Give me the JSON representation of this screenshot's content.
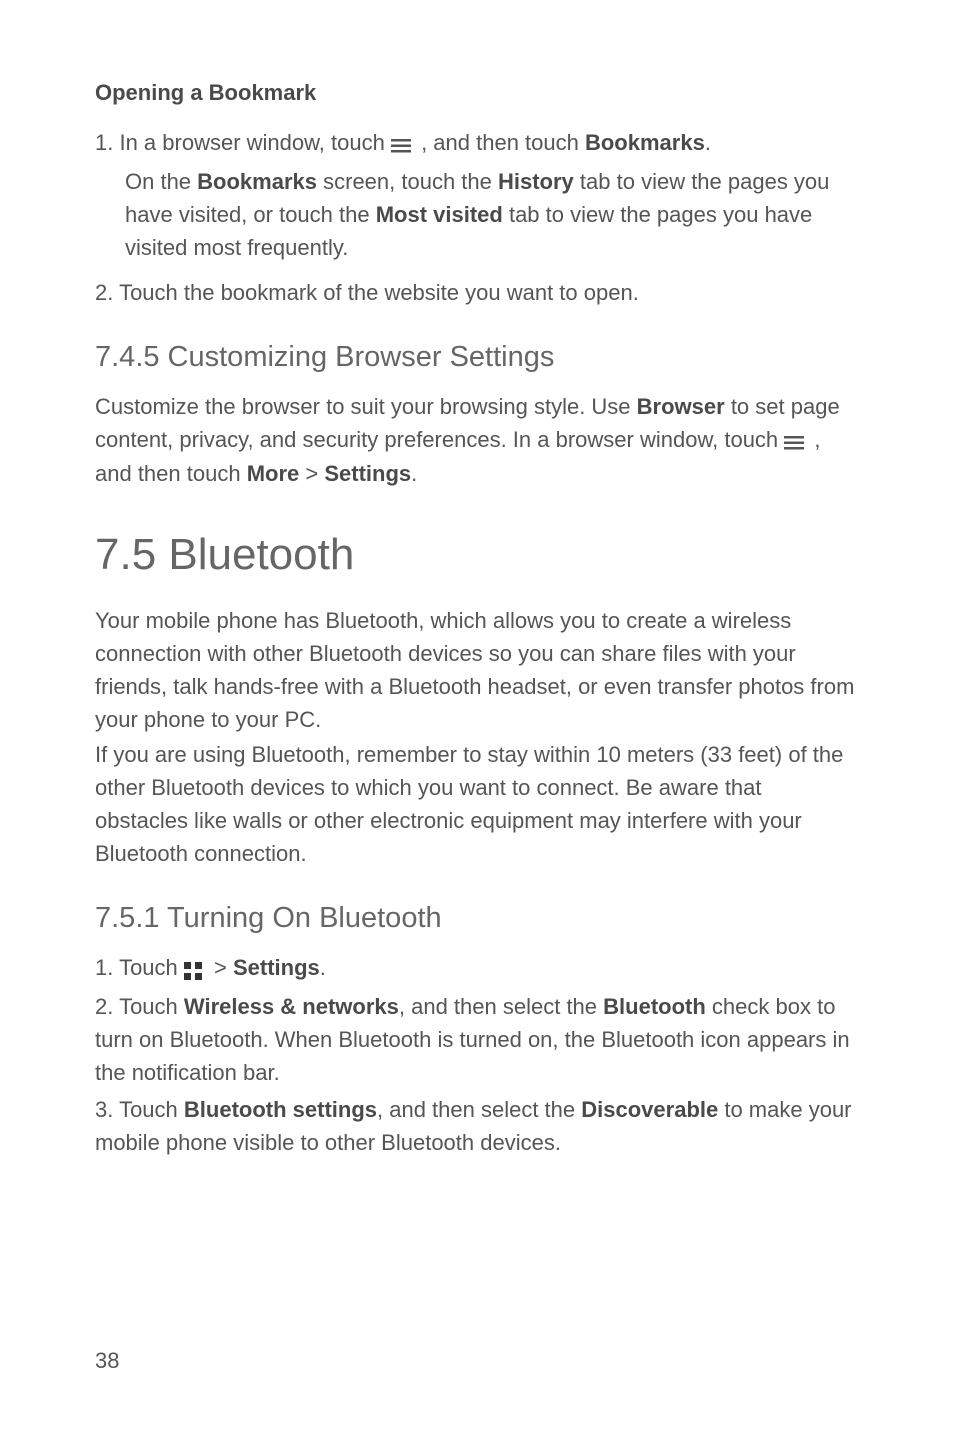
{
  "opening_bookmark": {
    "heading": "Opening a Bookmark",
    "step1_prefix": "1. In a browser window, touch ",
    "step1_suffix": " , and then touch ",
    "step1_bold": "Bookmarks",
    "step1_period": ".",
    "sub_prefix": "On the ",
    "sub_bold1": "Bookmarks",
    "sub_mid1": " screen, touch the ",
    "sub_bold2": "History",
    "sub_mid2": " tab to view the pages you have visited, or touch the ",
    "sub_bold3": "Most visited",
    "sub_suffix": " tab to view the pages you have visited most frequently.",
    "step2": "2. Touch the bookmark of the website you want to open."
  },
  "customizing": {
    "heading": "7.4.5  Customizing Browser Settings",
    "para_prefix": "Customize the browser to suit your browsing style. Use ",
    "para_bold1": "Browser",
    "para_mid1": " to set page content, privacy, and security preferences. In a browser window, touch ",
    "para_mid2": " , and then touch ",
    "para_bold2": "More",
    "para_gt": " > ",
    "para_bold3": "Settings",
    "para_period": "."
  },
  "bluetooth": {
    "heading": "7.5  Bluetooth",
    "para1": "Your mobile phone has Bluetooth, which allows you to create a wireless connection with other Bluetooth devices so you can share files with your friends, talk hands-free with a Bluetooth headset, or even transfer photos from your phone to your PC.",
    "para2": "If you are using Bluetooth, remember to stay within 10 meters (33 feet) of the other Bluetooth devices to which you want to connect. Be aware that obstacles like walls or other electronic equipment may interfere with your Bluetooth connection."
  },
  "turning_on": {
    "heading": "7.5.1  Turning On Bluetooth",
    "step1_prefix": "1. Touch ",
    "step1_gt": "  > ",
    "step1_bold": "Settings",
    "step1_period": ".",
    "step2_prefix": "2. Touch ",
    "step2_bold1": "Wireless & networks",
    "step2_mid": ", and then select the ",
    "step2_bold2": "Bluetooth",
    "step2_suffix": " check box to turn on Bluetooth. When Bluetooth is turned on, the Bluetooth icon appears in the notification bar.",
    "step3_prefix": "3. Touch ",
    "step3_bold1": "Bluetooth settings",
    "step3_mid": ", and then select the ",
    "step3_bold2": "Discoverable",
    "step3_suffix": " to make your mobile phone visible to other Bluetooth devices."
  },
  "page_number": "38"
}
